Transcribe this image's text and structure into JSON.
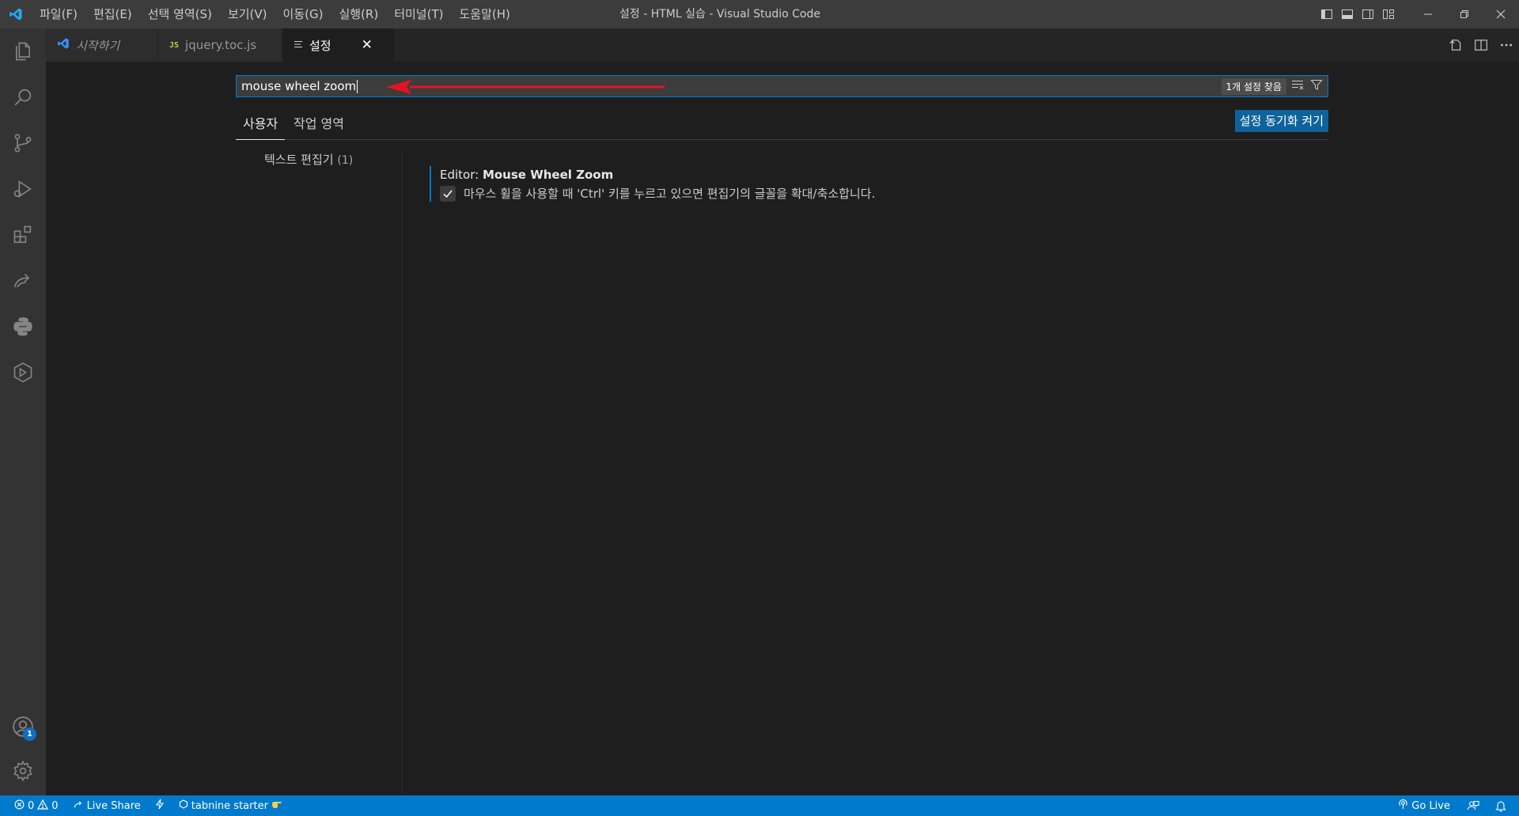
{
  "window": {
    "title": "설정 - HTML 실습 - Visual Studio Code"
  },
  "menu": [
    {
      "label": "파일(F)"
    },
    {
      "label": "편집(E)"
    },
    {
      "label": "선택 영역(S)"
    },
    {
      "label": "보기(V)"
    },
    {
      "label": "이동(G)"
    },
    {
      "label": "실행(R)"
    },
    {
      "label": "터미널(T)"
    },
    {
      "label": "도움말(H)"
    }
  ],
  "tabs": [
    {
      "label": "시작하기",
      "icon": "vscode-logo-icon",
      "italic": true,
      "active": false
    },
    {
      "label": "jquery.toc.js",
      "icon": "js-file-icon",
      "icon_text": "JS",
      "active": false
    },
    {
      "label": "설정",
      "icon": "settings-editor-icon",
      "active": true
    }
  ],
  "activity_bar": {
    "items": [
      "explorer-icon",
      "search-icon",
      "source-control-icon",
      "run-debug-icon",
      "extensions-icon",
      "live-share-icon",
      "python-icon",
      "remote-explorer-icon"
    ],
    "accounts_badge": "1"
  },
  "settings": {
    "search_value": "mouse wheel zoom",
    "result_count": "1개 설정 찾음",
    "scope_tabs": [
      "사용자",
      "작업 영역"
    ],
    "active_scope": "사용자",
    "sync_button": "설정 동기화 켜기",
    "toc": [
      {
        "label": "텍스트 편집기",
        "count": "(1)"
      }
    ],
    "items": [
      {
        "category": "Editor: ",
        "name": "Mouse Wheel Zoom",
        "description": "마우스 휠을 사용할 때 'Ctrl' 키를 누르고 있으면 편집기의 글꼴을 확대/축소합니다.",
        "checked": true
      }
    ]
  },
  "status_bar": {
    "errors": "0",
    "warnings": "0",
    "live_share": "Live Share",
    "tabnine": "tabnine starter",
    "go_live": "Go Live"
  },
  "colors": {
    "accent": "#007acc",
    "annotation_arrow": "#e81123"
  }
}
